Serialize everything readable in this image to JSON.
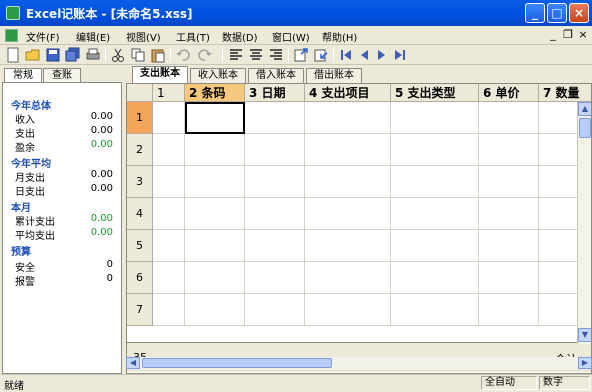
{
  "window": {
    "title": "Excel记账本 - [未命名5.xss]"
  },
  "menu": [
    "文件(F)",
    "编辑(E)",
    "视图(V)",
    "工具(T)",
    "数据(D)",
    "窗口(W)",
    "帮助(H)"
  ],
  "toolbar_icons": [
    "new-file-icon",
    "open-folder-icon",
    "save-icon",
    "save-all-icon",
    "print-icon",
    "cut-icon",
    "copy-icon",
    "paste-icon",
    "undo-icon",
    "redo-icon",
    "align-left-icon",
    "align-center-icon",
    "align-right-icon",
    "export-icon",
    "import-icon",
    "first-record-icon",
    "prev-record-icon",
    "next-record-icon",
    "last-record-icon"
  ],
  "sidebar": {
    "tabs": [
      "常规",
      "查账"
    ],
    "sections": [
      {
        "title": "今年总体",
        "rows": [
          {
            "label": "收入",
            "value": "0.00"
          },
          {
            "label": "支出",
            "value": "0.00"
          },
          {
            "label": "盈余",
            "value": "0.00"
          }
        ]
      },
      {
        "title": "今年平均",
        "rows": [
          {
            "label": "月支出",
            "value": "0.00"
          },
          {
            "label": "日支出",
            "value": "0.00"
          }
        ]
      },
      {
        "title": "本月",
        "rows": [
          {
            "label": "累计支出",
            "value": "0.00"
          },
          {
            "label": "平均支出",
            "value": "0.00"
          }
        ]
      },
      {
        "title": "预算",
        "rows": [
          {
            "label": "安全",
            "value": "0"
          },
          {
            "label": "报警",
            "value": "0"
          }
        ]
      }
    ]
  },
  "ledger_tabs": [
    "支出账本",
    "收入账本",
    "借入账本",
    "借出账本"
  ],
  "grid": {
    "columns": [
      "1",
      "2 条码",
      "3 日期",
      "4 支出项目",
      "5 支出类型",
      "6 单价",
      "7 数量"
    ],
    "row_numbers": [
      "1",
      "2",
      "3",
      "4",
      "5",
      "6",
      "7"
    ],
    "footer_row_number": "35",
    "footer_label": "合计"
  },
  "status": {
    "left": "就绪",
    "mid": "全自动",
    "right": "数字"
  },
  "colors": {
    "accent": "#0054e3",
    "selected_row": "#f5a55a",
    "selected_col": "#f5c87b",
    "positive": "#1a9c2b"
  }
}
